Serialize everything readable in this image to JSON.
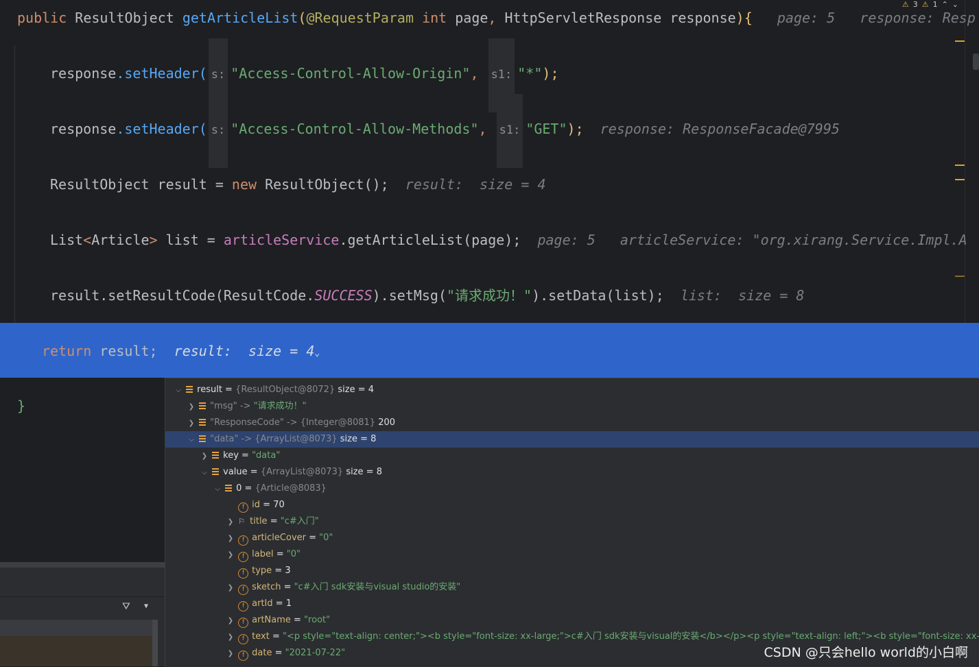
{
  "top_status": {
    "warnings": "3",
    "weak_warnings": "1"
  },
  "editor": {
    "signature": {
      "modifier": "public",
      "return_type": "ResultObject",
      "method_name": "getArticleList",
      "annotation": "@RequestParam",
      "param_type": "int",
      "param_name": "page",
      "sep": ", ",
      "param2_type": "HttpServletResponse",
      "param2_name": "response",
      "open": "){",
      "hint1": "page: 5",
      "hint2": "response: Resp"
    },
    "line1": {
      "obj": "response",
      "method": ".setHeader(",
      "tag1": "s:",
      "arg1": "\"Access-Control-Allow-Origin\"",
      "comma": ", ",
      "tag2": "s1:",
      "arg2": "\"*\"",
      "close": ");"
    },
    "line2": {
      "obj": "response",
      "method": ".setHeader(",
      "tag1": "s:",
      "arg1": "\"Access-Control-Allow-Methods\"",
      "comma": ", ",
      "tag2": "s1:",
      "arg2": "\"GET\"",
      "close": ");",
      "hint": "response: ResponseFacade@7995"
    },
    "line3": {
      "code": "ResultObject result = ",
      "new_kw": "new",
      "ctor": " ResultObject();",
      "hint": "result:  size = 4"
    },
    "line4": {
      "type": "List",
      "generic_open": "<",
      "generic": "Article",
      "generic_close": ">",
      "var": " list = ",
      "service": "articleService",
      "call": ".getArticleList(page);",
      "hint1": "page: 5",
      "hint2": "articleService: \"org.xirang.Service.Impl.A"
    },
    "line5": {
      "obj": "result",
      "m1": ".setResultCode(",
      "cls": "ResultCode.",
      "const": "SUCCESS",
      "m2": ").setMsg(",
      "msg": "\"请求成功！\"",
      "m3": ").setData(list);",
      "hint": "list:  size = 8"
    },
    "line6": {
      "ret": "return",
      "expr": " result;",
      "hint": "result:  size = 4",
      "chev": "⌄"
    },
    "closing_brace": "}"
  },
  "debug_tree": [
    {
      "indent": 0,
      "expand": "open",
      "icon": "stack",
      "name": "result",
      "eq": " = ",
      "ref": "{ResultObject@8072}",
      "extra": " size = 4"
    },
    {
      "indent": 1,
      "expand": "closed",
      "icon": "stack",
      "key": "\"msg\"",
      "arrow": " -> ",
      "value": "\"请求成功！\""
    },
    {
      "indent": 1,
      "expand": "closed",
      "icon": "stack",
      "key": "\"ResponseCode\"",
      "arrow": " -> ",
      "ref": "{Integer@8081}",
      "extra": " 200"
    },
    {
      "indent": 1,
      "expand": "open",
      "icon": "stack",
      "key": "\"data\"",
      "arrow": " -> ",
      "ref": "{ArrayList@8073}",
      "extra": " size = 8",
      "selected": true
    },
    {
      "indent": 2,
      "expand": "closed",
      "icon": "stack",
      "name": "key",
      "eq": " = ",
      "value": "\"data\""
    },
    {
      "indent": 2,
      "expand": "open",
      "icon": "stack",
      "name": "value",
      "eq": " = ",
      "ref": "{ArrayList@8073}",
      "extra": " size = 8"
    },
    {
      "indent": 3,
      "expand": "open",
      "icon": "stack",
      "name": "0",
      "eq": " = ",
      "ref": "{Article@8083}"
    },
    {
      "indent": 4,
      "expand": "none",
      "icon": "f",
      "name": "id",
      "eq": " = ",
      "num": "70"
    },
    {
      "indent": 4,
      "expand": "closed",
      "icon": "flag",
      "name": "title",
      "eq": " = ",
      "value": "\"c#入门\""
    },
    {
      "indent": 4,
      "expand": "closed",
      "icon": "f",
      "name": "articleCover",
      "eq": " = ",
      "value": "\"0\""
    },
    {
      "indent": 4,
      "expand": "closed",
      "icon": "f",
      "name": "label",
      "eq": " = ",
      "value": "\"0\""
    },
    {
      "indent": 4,
      "expand": "none",
      "icon": "f",
      "name": "type",
      "eq": " = ",
      "num": "3"
    },
    {
      "indent": 4,
      "expand": "closed",
      "icon": "f",
      "name": "sketch",
      "eq": " = ",
      "value": "\"c#入门 sdk安装与visual studio的安装\""
    },
    {
      "indent": 4,
      "expand": "none",
      "icon": "f",
      "name": "artId",
      "eq": " = ",
      "num": "1"
    },
    {
      "indent": 4,
      "expand": "closed",
      "icon": "f",
      "name": "artName",
      "eq": " = ",
      "value": "\"root\""
    },
    {
      "indent": 4,
      "expand": "closed",
      "icon": "f",
      "name": "text",
      "eq": " = ",
      "value": "\"<p style=\"text-align: center;\"><b style=\"font-size: xx-large;\">c#入门 sdk安装与visual的安装</b></p><p style=\"text-align: left;\"><b style=\"font-size: xx-large;\">c"
    },
    {
      "indent": 4,
      "expand": "closed",
      "icon": "f",
      "name": "date",
      "eq": " = ",
      "value": "\"2021-07-22\""
    }
  ],
  "icons": {
    "filter": "filter-icon",
    "dropdown": "dropdown-arrow-icon"
  },
  "watermark": "CSDN @只会hello world的小白啊"
}
